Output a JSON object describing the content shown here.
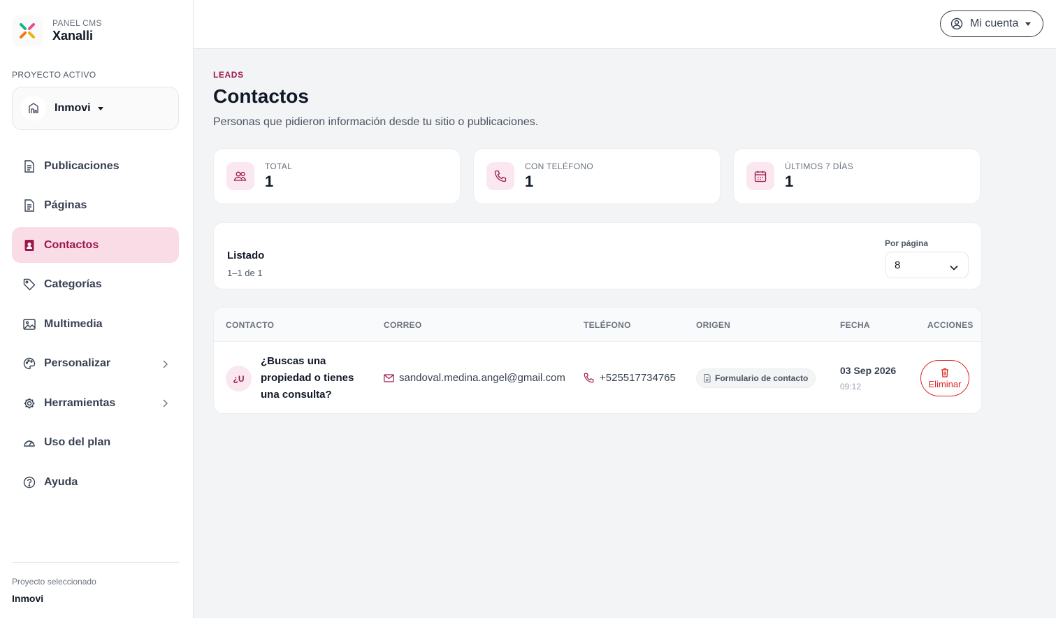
{
  "brand": {
    "subtitle": "PANEL CMS",
    "name": "Xanalli"
  },
  "project": {
    "label": "PROYECTO ACTIVO",
    "name": "Inmovi"
  },
  "sidebar": {
    "items": [
      {
        "label": "Publicaciones",
        "icon": "file-text-icon"
      },
      {
        "label": "Páginas",
        "icon": "file-text-icon"
      },
      {
        "label": "Contactos",
        "icon": "contact-book-icon",
        "active": true
      },
      {
        "label": "Categorías",
        "icon": "tag-icon"
      },
      {
        "label": "Multimedia",
        "icon": "image-icon"
      },
      {
        "label": "Personalizar",
        "icon": "palette-icon",
        "has_submenu": true
      },
      {
        "label": "Herramientas",
        "icon": "gear-icon",
        "has_submenu": true
      },
      {
        "label": "Uso del plan",
        "icon": "speedometer-icon"
      },
      {
        "label": "Ayuda",
        "icon": "help-circle-icon"
      }
    ],
    "footer": {
      "label": "Proyecto seleccionado",
      "value": "Inmovi"
    }
  },
  "topbar": {
    "account_label": "Mi cuenta"
  },
  "page": {
    "eyebrow": "LEADS",
    "title": "Contactos",
    "subtitle": "Personas que pidieron información desde tu sitio o publicaciones."
  },
  "stats": [
    {
      "label": "TOTAL",
      "value": "1",
      "icon": "users-icon"
    },
    {
      "label": "CON TELÉFONO",
      "value": "1",
      "icon": "phone-icon"
    },
    {
      "label": "ÚLTIMOS 7 DÍAS",
      "value": "1",
      "icon": "calendar-icon"
    }
  ],
  "listing": {
    "title": "Listado",
    "range": "1–1 de 1",
    "per_page_label": "Por página",
    "per_page_value": "8"
  },
  "table": {
    "headers": [
      "CONTACTO",
      "CORREO",
      "TELÉFONO",
      "ORIGEN",
      "FECHA",
      "ACCIONES"
    ],
    "rows": [
      {
        "initials": "¿U",
        "name": "¿Buscas una propiedad o tienes una consulta?",
        "email": "sandoval.medina.angel@gmail.com",
        "phone": "+525517734765",
        "origin": "Formulario de contacto",
        "date": "03 Sep 2026",
        "time": "09:12",
        "action_label": "Eliminar"
      }
    ]
  },
  "colors": {
    "accent": "#9d174d",
    "accent_bg": "#f9dce6",
    "danger": "#dc2626"
  }
}
